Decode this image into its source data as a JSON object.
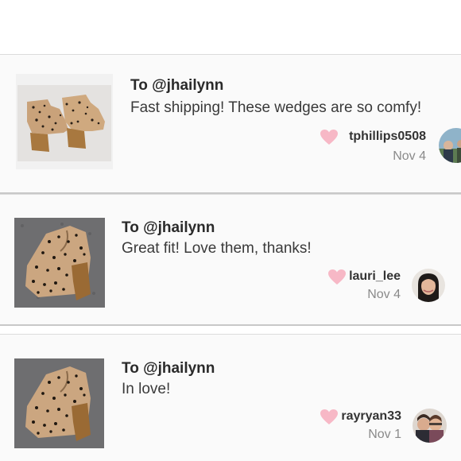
{
  "comments": [
    {
      "to": "To @jhailynn",
      "message": "Fast shipping! These wedges are so comfy!",
      "username": "tphillips0508",
      "date": "Nov 4",
      "heart_icon": "heart-icon"
    },
    {
      "to": "To @jhailynn",
      "message": "Great fit! Love them, thanks!",
      "username": "lauri_lee",
      "date": "Nov 4",
      "heart_icon": "heart-icon"
    },
    {
      "to": "To @jhailynn",
      "message": "In love!",
      "username": "rayryan33",
      "date": "Nov 1",
      "heart_icon": "heart-icon"
    }
  ],
  "colors": {
    "heart": "#f7b8c6",
    "card_background": "#fafafa",
    "divider": "#c8c8c8"
  }
}
